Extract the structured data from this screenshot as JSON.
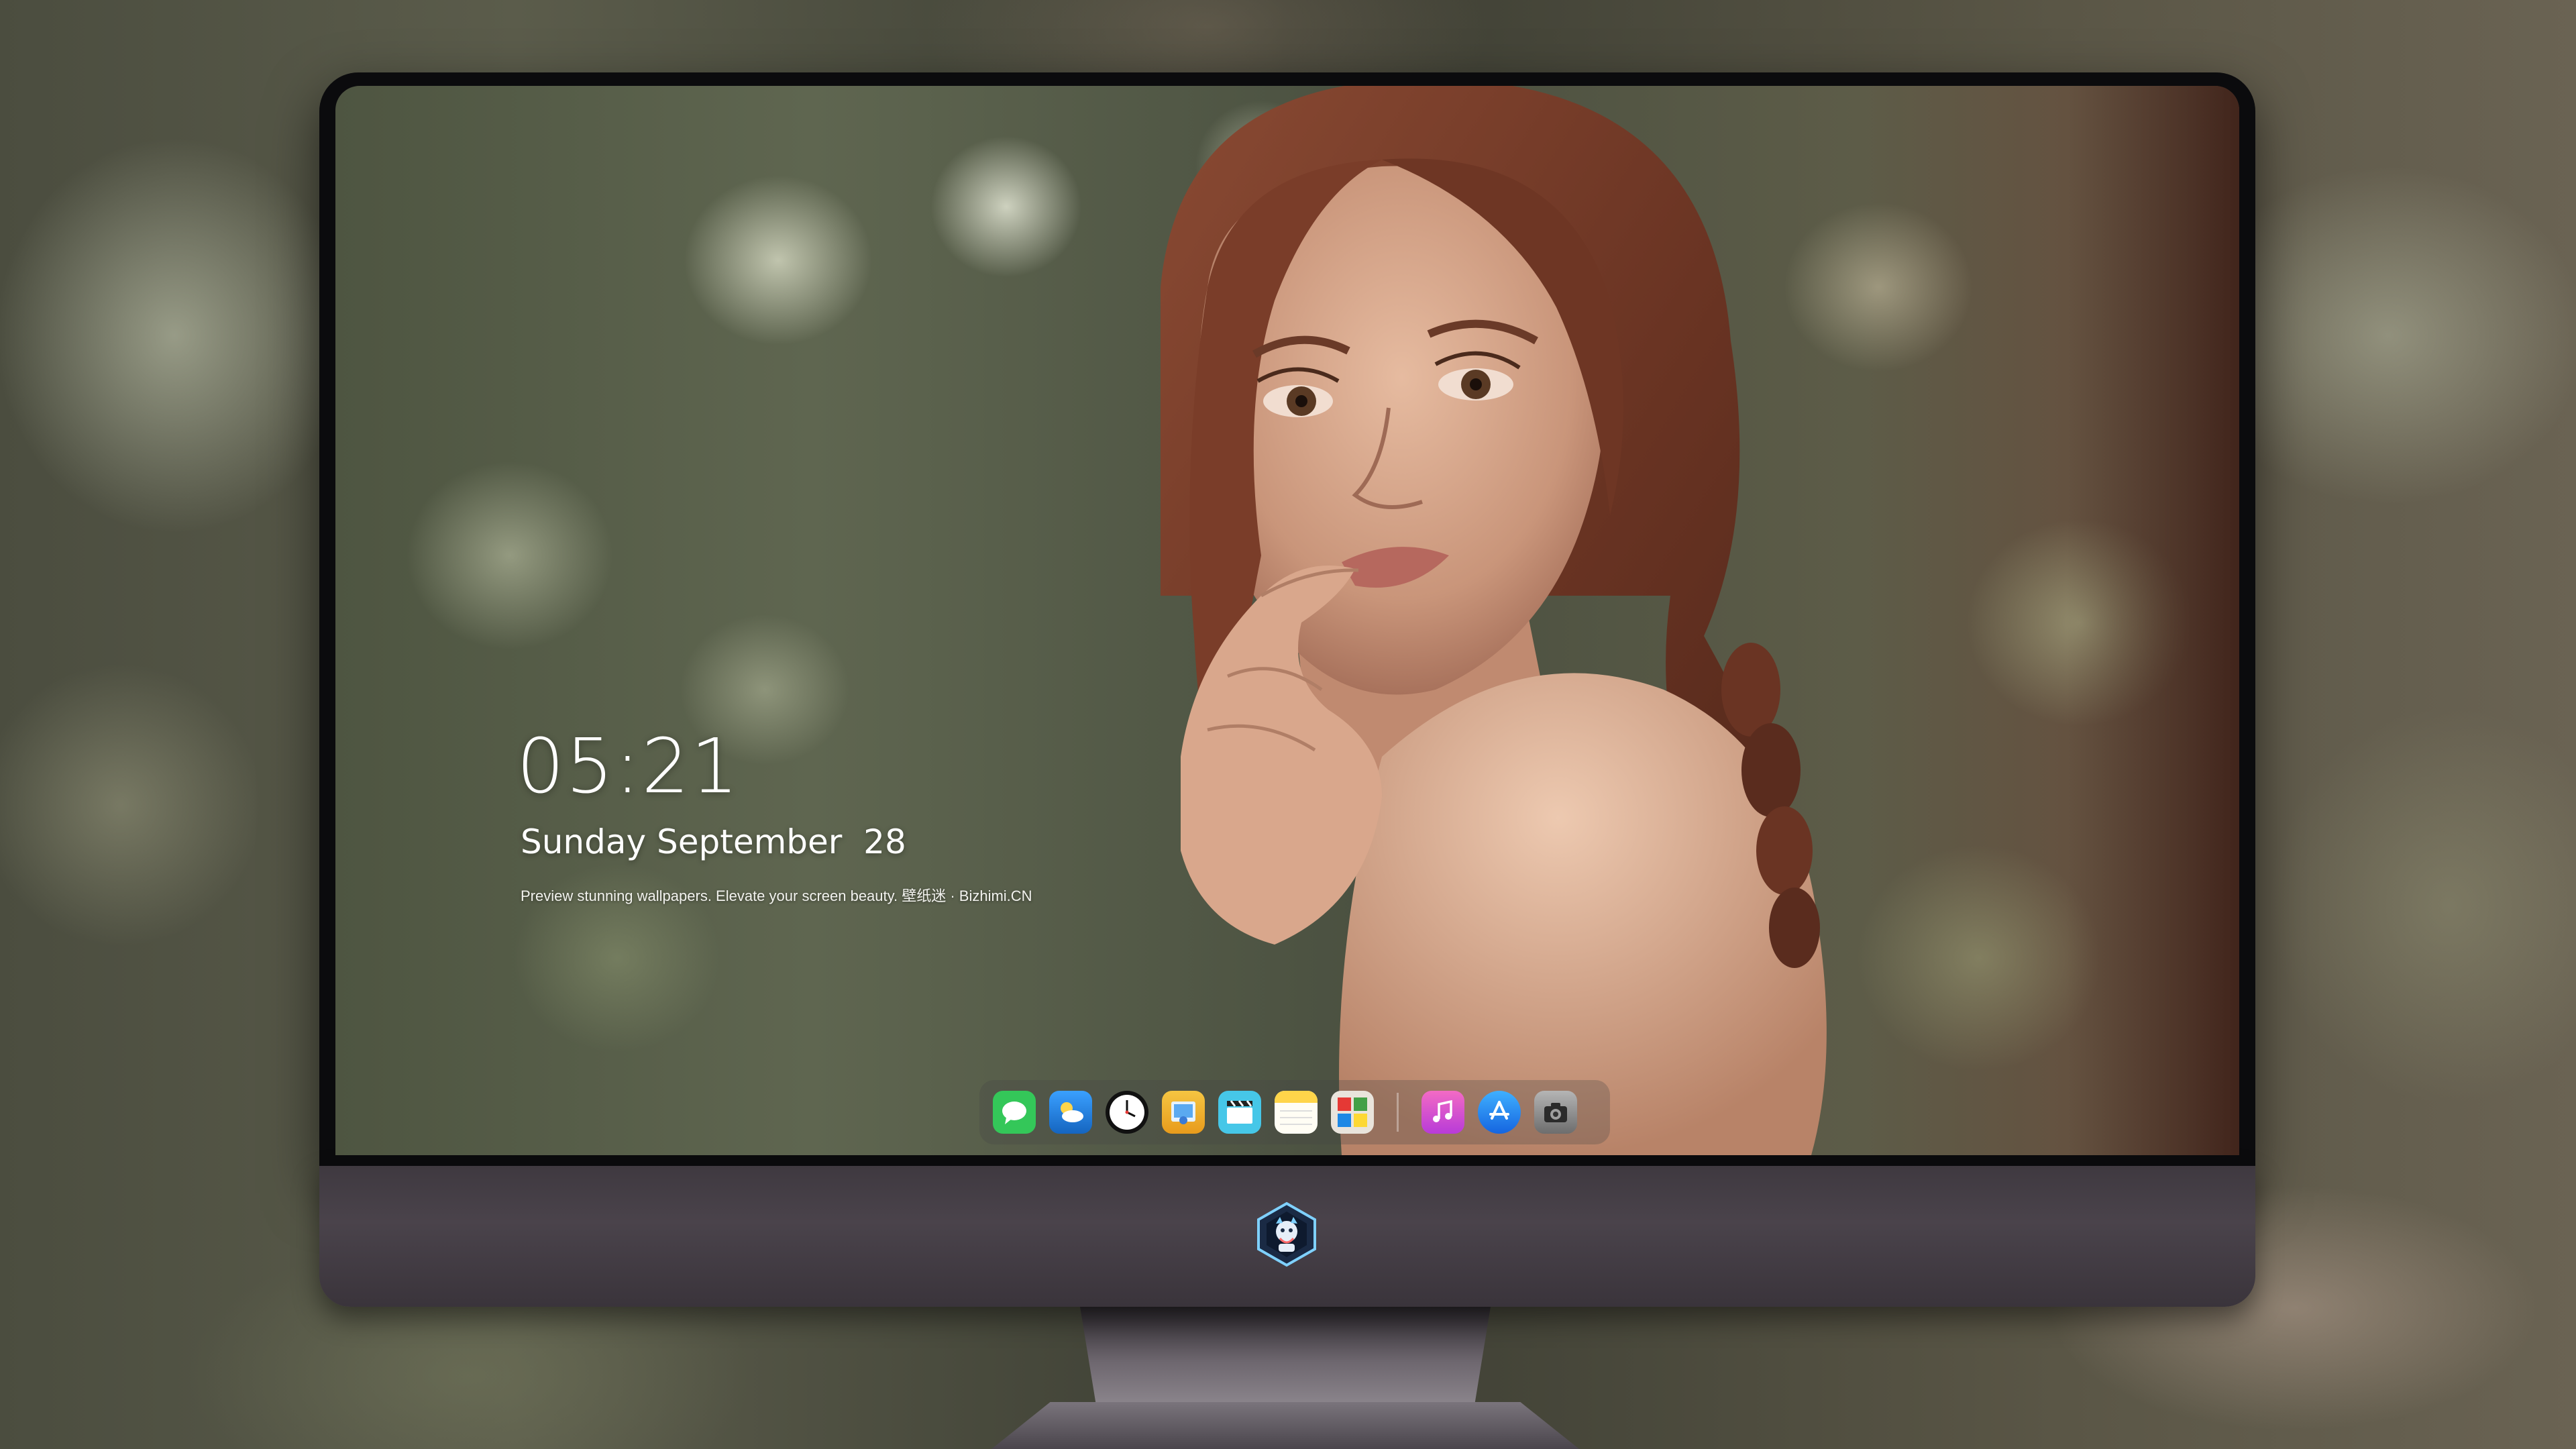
{
  "lockscreen": {
    "time": "05:21",
    "date": "Sunday September  28",
    "tagline": "Preview stunning wallpapers. Elevate your screen beauty. 壁纸迷 · Bizhimi.CN"
  },
  "dock": {
    "apps": [
      {
        "name": "messages",
        "icon": "message-bubble-icon",
        "color": "#34c759"
      },
      {
        "name": "weather",
        "icon": "cloud-sun-icon",
        "color": "#1e88e5"
      },
      {
        "name": "clock",
        "icon": "clock-icon",
        "color": "#111111"
      },
      {
        "name": "preview",
        "icon": "photo-viewer-icon",
        "color": "#f5c542"
      },
      {
        "name": "clips",
        "icon": "clapperboard-icon",
        "color": "#46c7e8"
      },
      {
        "name": "notes",
        "icon": "notes-icon",
        "color": "#ffd54a"
      },
      {
        "name": "photo-booth",
        "icon": "photo-grid-icon",
        "color": "#e9e4dc"
      },
      {
        "name": "music",
        "icon": "music-note-icon",
        "color": "#e54aa8"
      },
      {
        "name": "app-store",
        "icon": "app-store-icon",
        "color": "#1f8fff"
      },
      {
        "name": "camera",
        "icon": "camera-icon",
        "color": "#8a8a8a"
      }
    ]
  },
  "monitor": {
    "logo": "dragon-shield-logo"
  }
}
